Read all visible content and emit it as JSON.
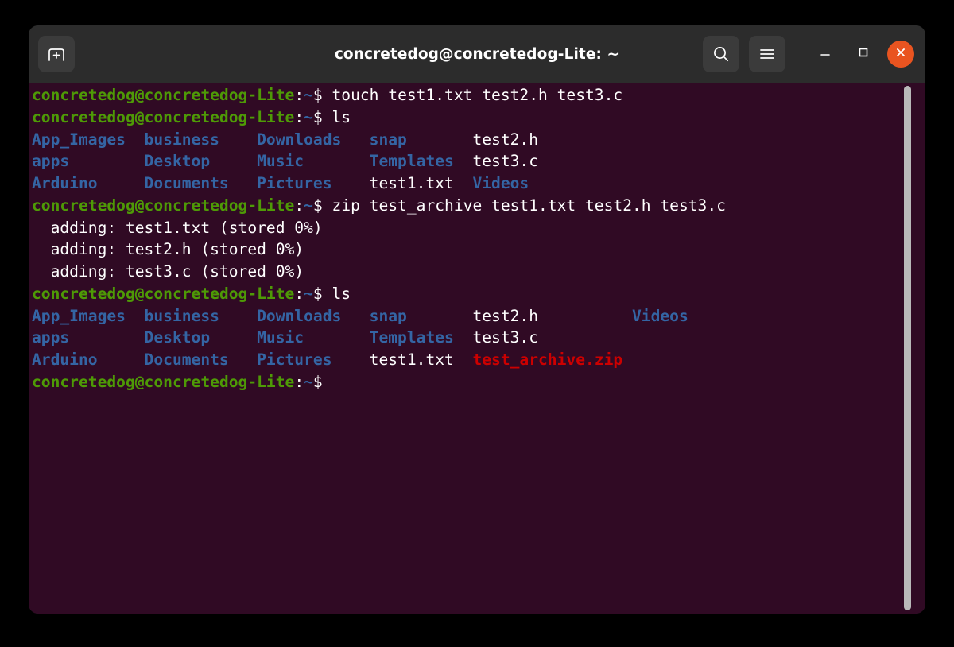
{
  "window": {
    "title": "concretedog@concretedog-Lite: ~",
    "accent_color": "#e95420",
    "titlebar_bg": "#2c2c2c",
    "terminal_bg": "#300a24"
  },
  "titlebar": {
    "new_tab_label": "new-tab",
    "search_label": "search",
    "menu_label": "menu",
    "minimize_label": "minimize",
    "maximize_label": "maximize",
    "close_label": "close"
  },
  "colors": {
    "prompt_green": "#4e9a06",
    "dir_blue": "#3465a4",
    "file_white": "#ffffff",
    "archive_red": "#cc0000"
  },
  "terminal": {
    "prompt": "concretedog@concretedog-Lite",
    "prompt_path": ":~$",
    "lines": [
      {
        "type": "prompt",
        "segments": [
          {
            "text": "concretedog@concretedog-Lite",
            "color": "green"
          },
          {
            "text": ":",
            "color": "white"
          },
          {
            "text": "~",
            "color": "blue"
          },
          {
            "text": "$ ",
            "color": "white"
          },
          {
            "text": "touch test1.txt test2.h test3.c",
            "color": "white"
          }
        ]
      },
      {
        "type": "prompt",
        "segments": [
          {
            "text": "concretedog@concretedog-Lite",
            "color": "green"
          },
          {
            "text": ":",
            "color": "white"
          },
          {
            "text": "~",
            "color": "blue"
          },
          {
            "text": "$ ",
            "color": "white"
          },
          {
            "text": "ls",
            "color": "white"
          }
        ]
      },
      {
        "type": "output",
        "segments": [
          {
            "text": "App_Images  business    Downloads   snap       ",
            "color": "blue"
          },
          {
            "text": "test2.h",
            "color": "white"
          }
        ]
      },
      {
        "type": "output",
        "segments": [
          {
            "text": "apps        Desktop     Music       Templates  ",
            "color": "blue"
          },
          {
            "text": "test3.c",
            "color": "white"
          }
        ]
      },
      {
        "type": "output",
        "segments": [
          {
            "text": "Arduino     Documents   Pictures    ",
            "color": "blue"
          },
          {
            "text": "test1.txt  ",
            "color": "white"
          },
          {
            "text": "Videos",
            "color": "blue"
          }
        ]
      },
      {
        "type": "prompt",
        "segments": [
          {
            "text": "concretedog@concretedog-Lite",
            "color": "green"
          },
          {
            "text": ":",
            "color": "white"
          },
          {
            "text": "~",
            "color": "blue"
          },
          {
            "text": "$ ",
            "color": "white"
          },
          {
            "text": "zip test_archive test1.txt test2.h test3.c",
            "color": "white"
          }
        ]
      },
      {
        "type": "output",
        "segments": [
          {
            "text": "  adding: test1.txt (stored 0%)",
            "color": "white"
          }
        ]
      },
      {
        "type": "output",
        "segments": [
          {
            "text": "  adding: test2.h (stored 0%)",
            "color": "white"
          }
        ]
      },
      {
        "type": "output",
        "segments": [
          {
            "text": "  adding: test3.c (stored 0%)",
            "color": "white"
          }
        ]
      },
      {
        "type": "prompt",
        "segments": [
          {
            "text": "concretedog@concretedog-Lite",
            "color": "green"
          },
          {
            "text": ":",
            "color": "white"
          },
          {
            "text": "~",
            "color": "blue"
          },
          {
            "text": "$ ",
            "color": "white"
          },
          {
            "text": "ls",
            "color": "white"
          }
        ]
      },
      {
        "type": "output",
        "segments": [
          {
            "text": "App_Images  business    Downloads   snap       ",
            "color": "blue"
          },
          {
            "text": "test2.h          ",
            "color": "white"
          },
          {
            "text": "Videos",
            "color": "blue"
          }
        ]
      },
      {
        "type": "output",
        "segments": [
          {
            "text": "apps        Desktop     Music       Templates  ",
            "color": "blue"
          },
          {
            "text": "test3.c",
            "color": "white"
          }
        ]
      },
      {
        "type": "output",
        "segments": [
          {
            "text": "Arduino     Documents   Pictures    ",
            "color": "blue"
          },
          {
            "text": "test1.txt  ",
            "color": "white"
          },
          {
            "text": "test_archive.zip",
            "color": "red"
          }
        ]
      },
      {
        "type": "prompt",
        "segments": [
          {
            "text": "concretedog@concretedog-Lite",
            "color": "green"
          },
          {
            "text": ":",
            "color": "white"
          },
          {
            "text": "~",
            "color": "blue"
          },
          {
            "text": "$",
            "color": "white"
          }
        ]
      }
    ]
  },
  "scrollbar": {
    "label": "terminal-scrollbar"
  }
}
